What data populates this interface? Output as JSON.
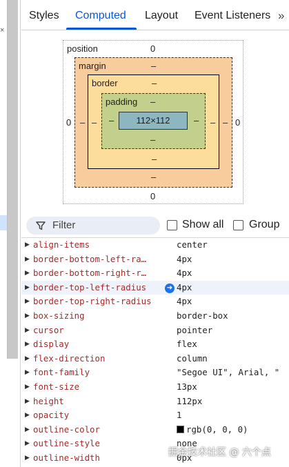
{
  "tabs": [
    {
      "label": "Styles"
    },
    {
      "label": "Computed"
    },
    {
      "label": "Layout"
    },
    {
      "label": "Event Listeners"
    }
  ],
  "more_label": "»",
  "box_model": {
    "position_label": "position",
    "position_top": "0",
    "position_left": "0",
    "position_right": "0",
    "position_bottom": "0",
    "margin_label": "margin",
    "margin_top": "–",
    "margin_left": "–",
    "margin_right": "–",
    "margin_bottom": "–",
    "border_label": "border",
    "border_top": "–",
    "border_left": "–",
    "border_right": "–",
    "border_bottom": "–",
    "padding_label": "padding",
    "padding_top": "–",
    "padding_left": "–",
    "padding_right": "–",
    "padding_bottom": "–",
    "content_size": "112×112"
  },
  "filter": {
    "placeholder": "Filter",
    "show_all_label": "Show all",
    "group_label": "Group"
  },
  "properties": [
    {
      "name": "align-items",
      "value": "center"
    },
    {
      "name": "border-bottom-left-ra…",
      "value": "4px"
    },
    {
      "name": "border-bottom-right-r…",
      "value": "4px"
    },
    {
      "name": "border-top-left-radius",
      "value": "4px"
    },
    {
      "name": "border-top-right-radius",
      "value": "4px"
    },
    {
      "name": "box-sizing",
      "value": "border-box"
    },
    {
      "name": "cursor",
      "value": "pointer"
    },
    {
      "name": "display",
      "value": "flex"
    },
    {
      "name": "flex-direction",
      "value": "column"
    },
    {
      "name": "font-family",
      "value": "\"Segoe UI\", Arial, \""
    },
    {
      "name": "font-size",
      "value": "13px"
    },
    {
      "name": "height",
      "value": "112px"
    },
    {
      "name": "opacity",
      "value": "1"
    },
    {
      "name": "outline-color",
      "value": "rgb(0, 0, 0)"
    },
    {
      "name": "outline-style",
      "value": "none"
    },
    {
      "name": "outline-width",
      "value": "0px"
    }
  ],
  "watermark": "掘金技术社区 @ 六个点",
  "colors": {
    "accent": "#0b57d0",
    "margin": "#f9cc9d",
    "border": "#fddd9b",
    "padding": "#c3d08b",
    "content": "#8cb6c0",
    "property_name": "#a52a2a"
  }
}
